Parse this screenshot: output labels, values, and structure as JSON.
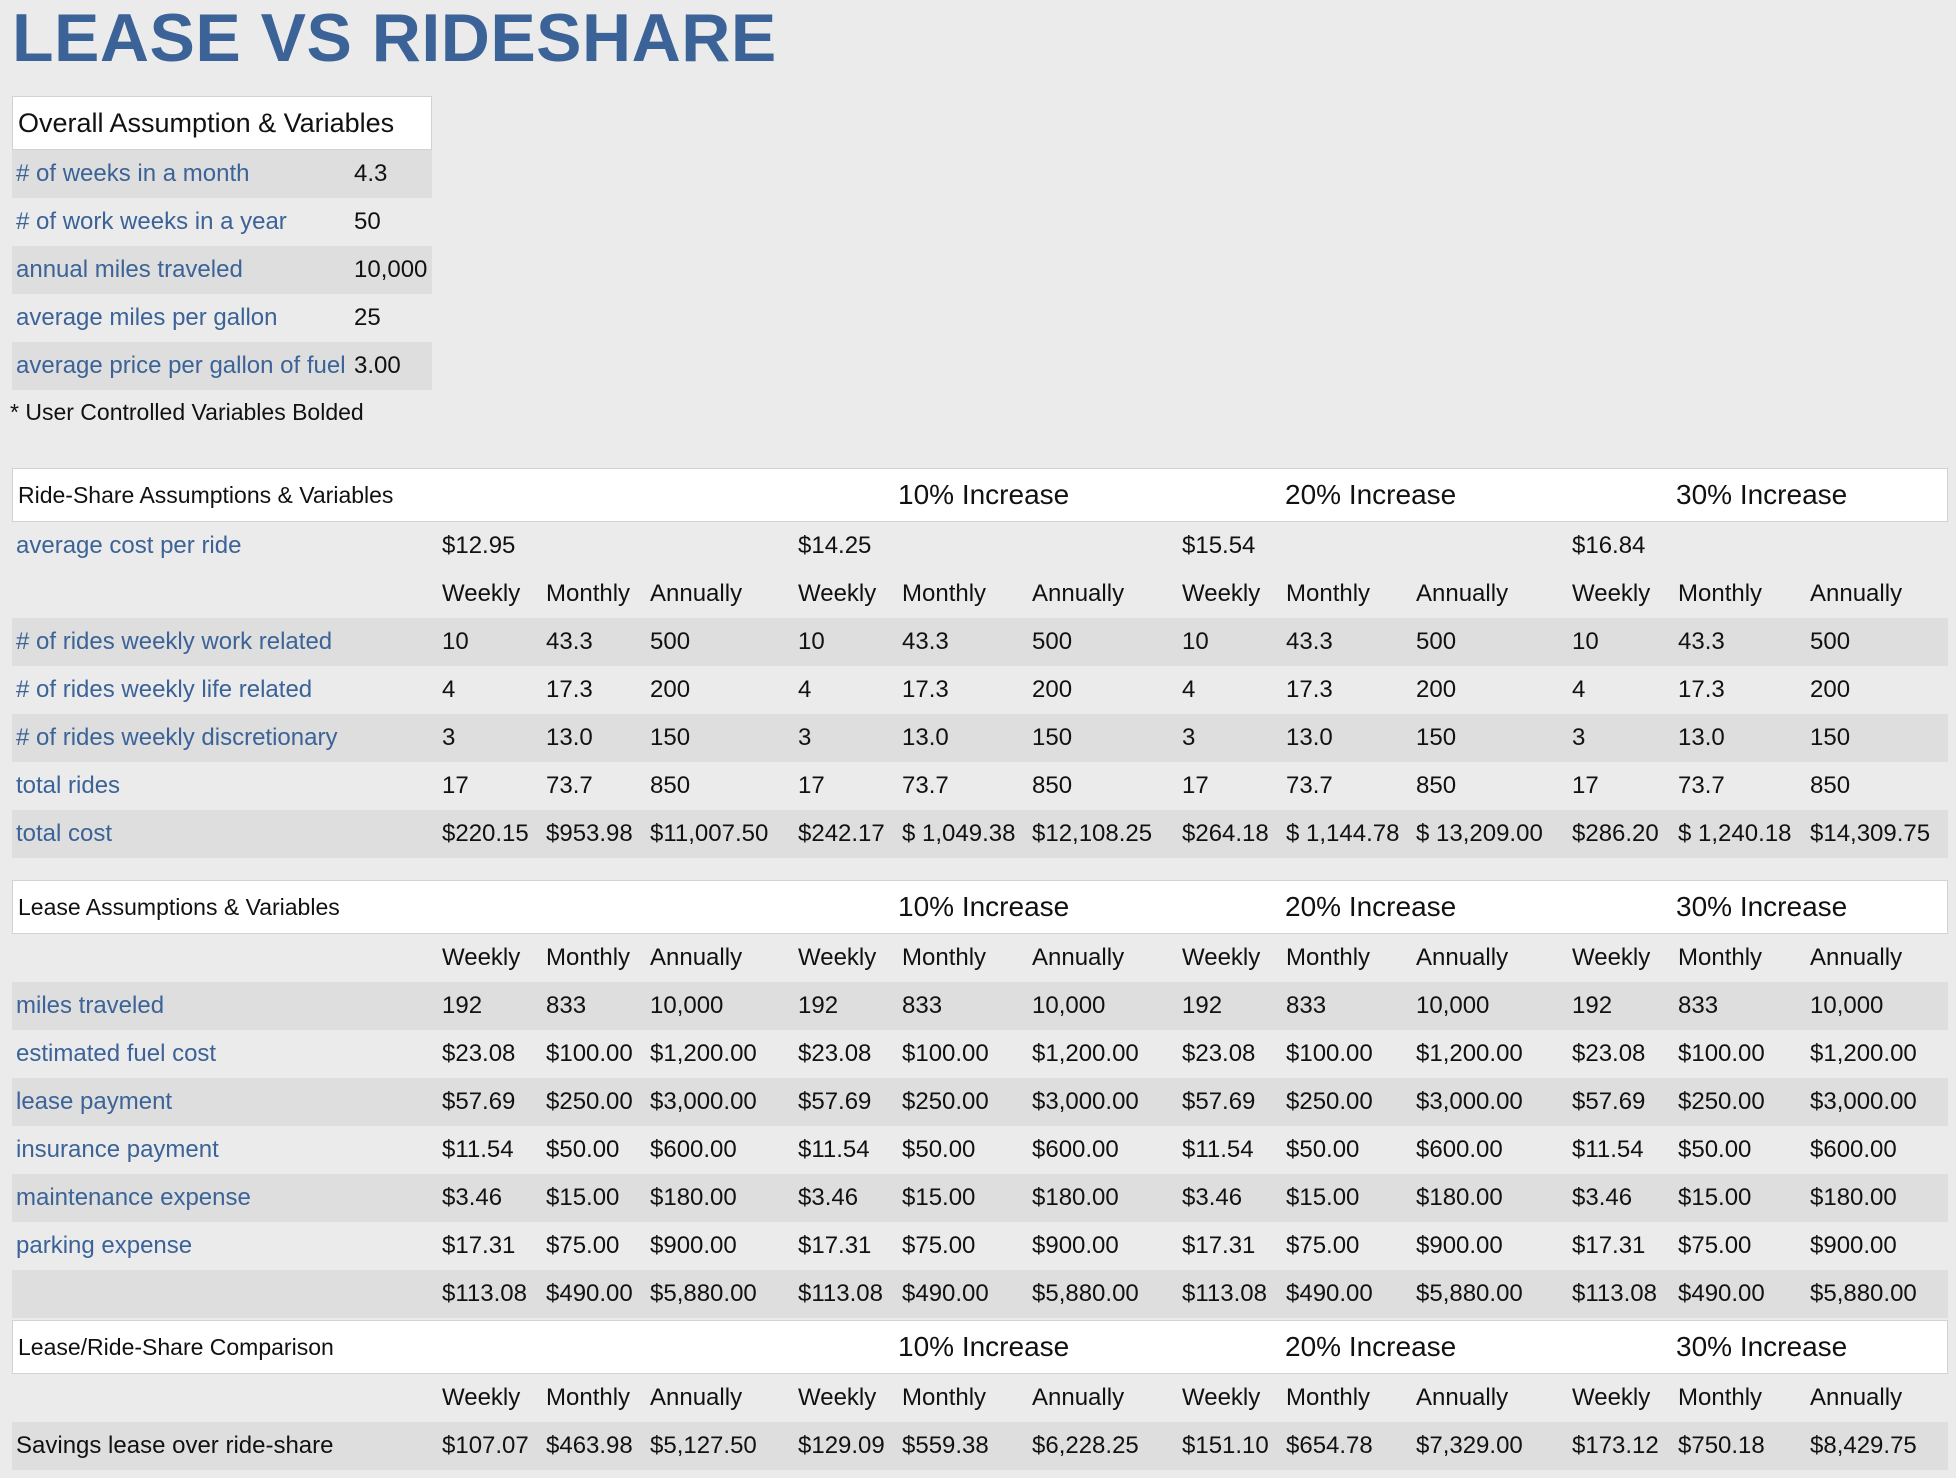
{
  "title": "LEASE VS RIDESHARE",
  "overall": {
    "header": "Overall Assumption & Variables",
    "rows": [
      {
        "label": "# of weeks in a month",
        "value": "4.3"
      },
      {
        "label": "# of work weeks in a year",
        "value": "50"
      },
      {
        "label": "annual miles traveled",
        "value": "10,000"
      },
      {
        "label": "average miles per gallon",
        "value": "25"
      },
      {
        "label": "average price per gallon of fuel",
        "value": "3.00"
      }
    ],
    "note": "* User Controlled Variables Bolded"
  },
  "colHeaders": [
    "Weekly",
    "Monthly",
    "Annually"
  ],
  "increases": [
    "10% Increase",
    "20% Increase",
    "30% Increase"
  ],
  "rideshare": {
    "header": "Ride-Share Assumptions & Variables",
    "avgCostLabel": "average cost per ride",
    "avgCosts": [
      "$12.95",
      "$14.25",
      "$15.54",
      "$16.84"
    ],
    "rows": [
      {
        "label": "# of rides weekly work related",
        "values": [
          "10",
          "43.3",
          "500",
          "10",
          "43.3",
          "500",
          "10",
          "43.3",
          "500",
          "10",
          "43.3",
          "500"
        ]
      },
      {
        "label": "# of rides weekly life related",
        "values": [
          "4",
          "17.3",
          "200",
          "4",
          "17.3",
          "200",
          "4",
          "17.3",
          "200",
          "4",
          "17.3",
          "200"
        ]
      },
      {
        "label": "# of rides weekly discretionary",
        "values": [
          "3",
          "13.0",
          "150",
          "3",
          "13.0",
          "150",
          "3",
          "13.0",
          "150",
          "3",
          "13.0",
          "150"
        ]
      },
      {
        "label": "total rides",
        "values": [
          "17",
          "73.7",
          "850",
          "17",
          "73.7",
          "850",
          "17",
          "73.7",
          "850",
          "17",
          "73.7",
          "850"
        ]
      },
      {
        "label": "total cost",
        "values": [
          "$220.15",
          "$953.98",
          "$11,007.50",
          "$242.17",
          "$ 1,049.38",
          "$12,108.25",
          "$264.18",
          "$ 1,144.78",
          "$ 13,209.00",
          "$286.20",
          "$ 1,240.18",
          "$14,309.75"
        ]
      }
    ]
  },
  "lease": {
    "header": "Lease Assumptions & Variables",
    "rows": [
      {
        "label": "miles traveled",
        "values": [
          "192",
          "833",
          "10,000",
          "192",
          "833",
          "10,000",
          "192",
          "833",
          "10,000",
          "192",
          "833",
          "10,000"
        ]
      },
      {
        "label": "estimated fuel cost",
        "values": [
          "$23.08",
          "$100.00",
          "$1,200.00",
          "$23.08",
          "$100.00",
          "$1,200.00",
          "$23.08",
          "$100.00",
          "$1,200.00",
          "$23.08",
          "$100.00",
          "$1,200.00"
        ]
      },
      {
        "label": "lease payment",
        "values": [
          "$57.69",
          "$250.00",
          "$3,000.00",
          "$57.69",
          "$250.00",
          "$3,000.00",
          "$57.69",
          "$250.00",
          "$3,000.00",
          "$57.69",
          "$250.00",
          "$3,000.00"
        ]
      },
      {
        "label": "insurance payment",
        "values": [
          "$11.54",
          "$50.00",
          "$600.00",
          "$11.54",
          "$50.00",
          "$600.00",
          "$11.54",
          "$50.00",
          "$600.00",
          "$11.54",
          "$50.00",
          "$600.00"
        ]
      },
      {
        "label": "maintenance expense",
        "values": [
          "$3.46",
          "$15.00",
          "$180.00",
          "$3.46",
          "$15.00",
          "$180.00",
          "$3.46",
          "$15.00",
          "$180.00",
          "$3.46",
          "$15.00",
          "$180.00"
        ]
      },
      {
        "label": "parking expense",
        "values": [
          "$17.31",
          "$75.00",
          "$900.00",
          "$17.31",
          "$75.00",
          "$900.00",
          "$17.31",
          "$75.00",
          "$900.00",
          "$17.31",
          "$75.00",
          "$900.00"
        ]
      },
      {
        "label": "",
        "values": [
          "$113.08",
          "$490.00",
          "$5,880.00",
          "$113.08",
          "$490.00",
          "$5,880.00",
          "$113.08",
          "$490.00",
          "$5,880.00",
          "$113.08",
          "$490.00",
          "$5,880.00"
        ]
      }
    ]
  },
  "comparison": {
    "header": "Lease/Ride-Share Comparison",
    "rows": [
      {
        "label": "Savings lease over ride-share",
        "values": [
          "$107.07",
          "$463.98",
          "$5,127.50",
          "$129.09",
          "$559.38",
          "$6,228.25",
          "$151.10",
          "$654.78",
          "$7,329.00",
          "$173.12",
          "$750.18",
          "$8,429.75"
        ]
      }
    ]
  }
}
